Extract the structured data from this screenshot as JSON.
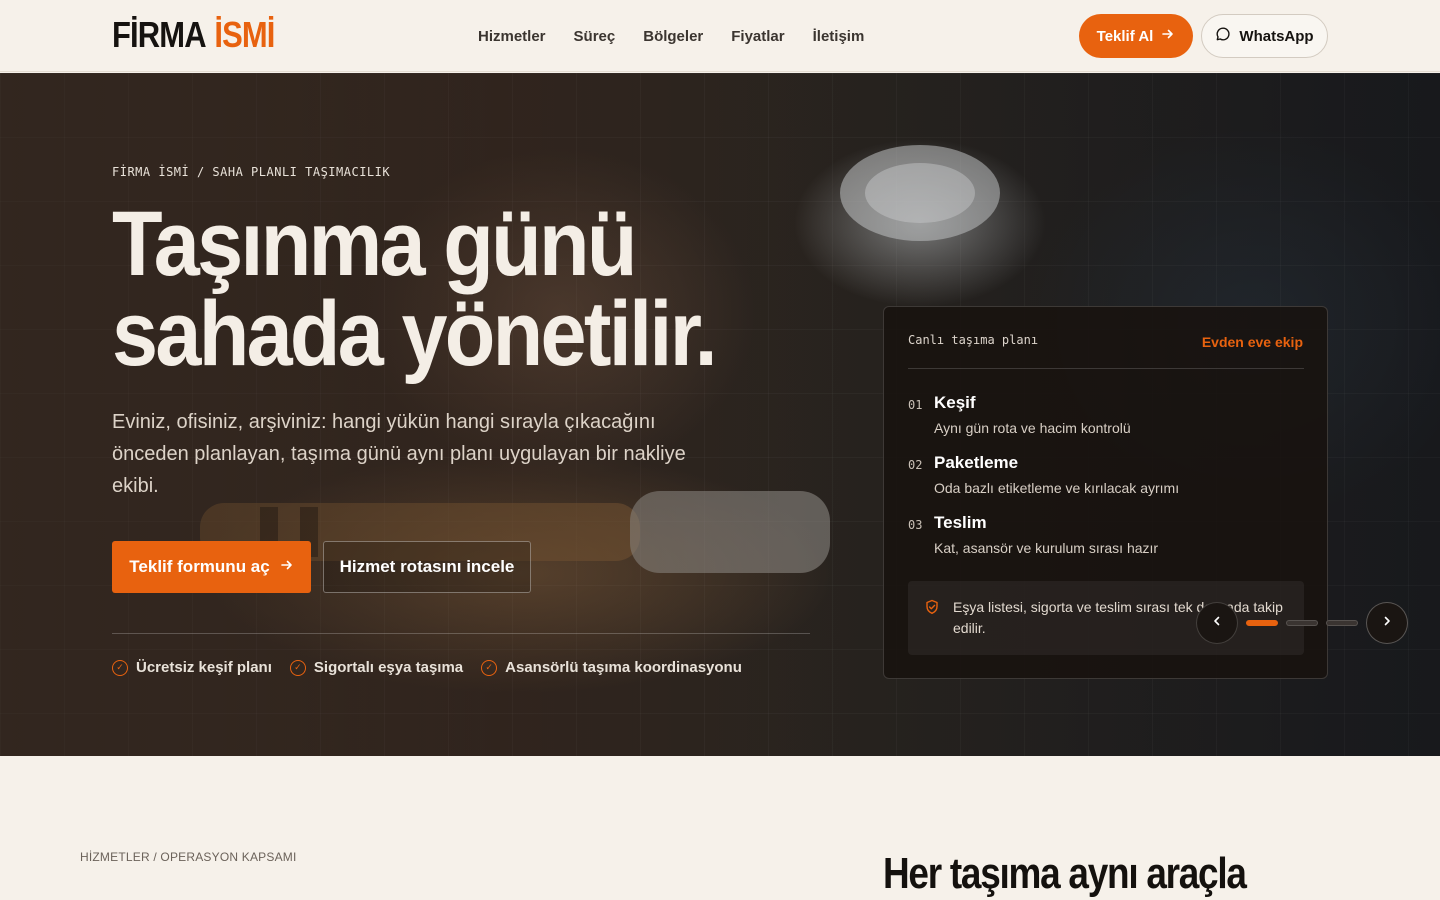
{
  "brand": {
    "logo_part1": "FİRMA",
    "logo_part2": "İSMİ",
    "accent": "#e8620f"
  },
  "nav": {
    "items": [
      {
        "label": "Hizmetler"
      },
      {
        "label": "Süreç"
      },
      {
        "label": "Bölgeler"
      },
      {
        "label": "Fiyatlar"
      },
      {
        "label": "İletişim"
      }
    ]
  },
  "header": {
    "quote_label": "Teklif Al",
    "whatsapp_label": "WhatsApp"
  },
  "hero": {
    "breadcrumb": "FİRMA İSMİ / SAHA PLANLI TAŞIMACILIK",
    "title_line1": "Taşınma günü",
    "title_line2": "sahada yönetilir",
    "title_dot": ".",
    "lead": "Eviniz, ofisiniz, arşiviniz: hangi yükün hangi sırayla çıkacağını önceden planlayan, taşıma günü aynı planı uygulayan bir nakliye ekibi.",
    "primary_button": "Teklif formunu aç",
    "secondary_button": "Hizmet rotasını incele",
    "features": [
      {
        "label": "Ücretsiz keşif planı"
      },
      {
        "label": "Sigortalı eşya taşıma"
      },
      {
        "label": "Asansörlü taşıma koordinasyonu"
      }
    ]
  },
  "plan_card": {
    "title": "Canlı taşıma planı",
    "tag": "Evden eve ekip",
    "steps": [
      {
        "num": "01",
        "title": "Keşif",
        "desc": "Aynı gün rota ve hacim kontrolü"
      },
      {
        "num": "02",
        "title": "Paketleme",
        "desc": "Oda bazlı etiketleme ve kırılacak ayrımı"
      },
      {
        "num": "03",
        "title": "Teslim",
        "desc": "Kat, asansör ve kurulum sırası hazır"
      }
    ],
    "note": "Eşya listesi, sigorta ve teslim sırası tek dosyada takip edilir."
  },
  "carousel": {
    "active_index": 0,
    "count": 3
  },
  "services": {
    "label": "HİZMETLER / OPERASYON KAPSAMI",
    "title": "Her taşıma aynı araçla"
  }
}
